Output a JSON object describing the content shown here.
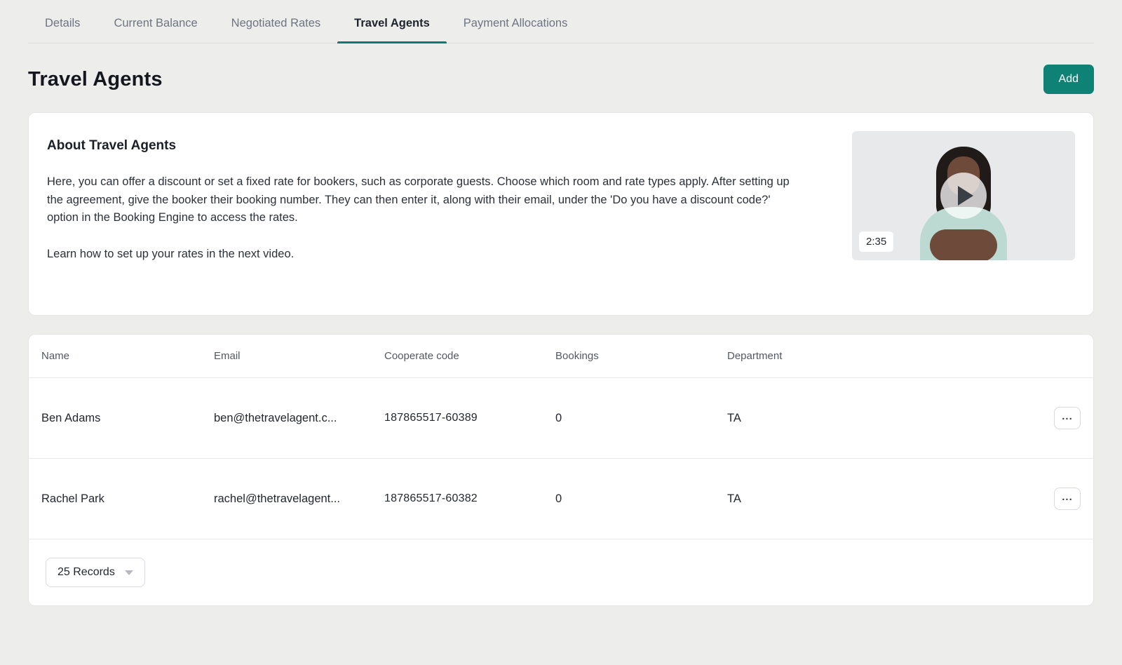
{
  "tabs": [
    {
      "label": "Details",
      "active": false
    },
    {
      "label": "Current Balance",
      "active": false
    },
    {
      "label": "Negotiated Rates",
      "active": false
    },
    {
      "label": "Travel Agents",
      "active": true
    },
    {
      "label": "Payment Allocations",
      "active": false
    }
  ],
  "page": {
    "title": "Travel Agents",
    "add_button_label": "Add"
  },
  "about": {
    "title": "About Travel Agents",
    "paragraph1": "Here, you can offer a discount or set a fixed rate for bookers, such as corporate guests. Choose which room and rate types apply. After setting up the agreement, give the booker their booking number. They can then enter it, along with their email, under the 'Do you have a discount code?' option in the Booking Engine to access the rates.",
    "paragraph2": "Learn how to set up your rates in the next video.",
    "video_duration": "2:35"
  },
  "table": {
    "columns": [
      "Name",
      "Email",
      "Cooperate code",
      "Bookings",
      "Department"
    ],
    "rows": [
      {
        "name": "Ben Adams",
        "email": "ben@thetravelagent.c...",
        "cooperate_code": "187865517-60389",
        "bookings": "0",
        "department": "TA",
        "menu_label": "..."
      },
      {
        "name": "Rachel Park",
        "email": "rachel@thetravelagent...",
        "cooperate_code": "187865517-60382",
        "bookings": "0",
        "department": "TA",
        "menu_label": "..."
      }
    ],
    "footer": {
      "records_selector": "25 Records"
    }
  },
  "colors": {
    "accent": "#0f8276",
    "background": "#ededec"
  }
}
